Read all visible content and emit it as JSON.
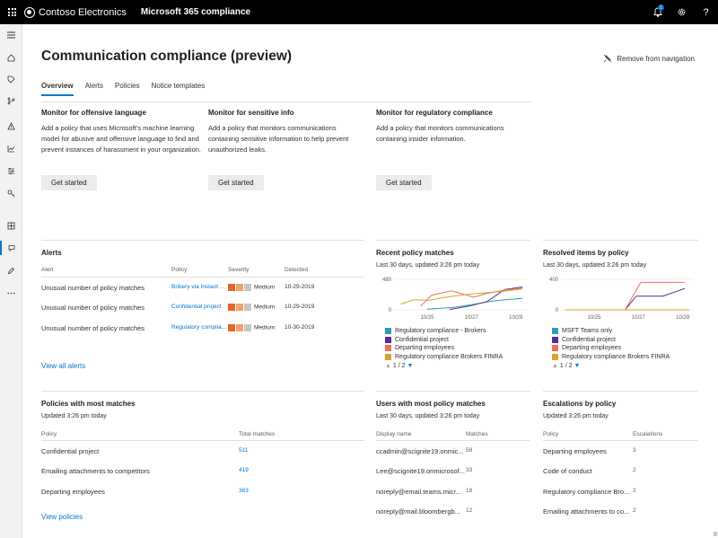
{
  "topbar": {
    "brand": "Contoso Electronics",
    "app_name": "Microsoft 365 compliance",
    "notification_count": "1",
    "help": "?"
  },
  "page": {
    "title": "Communication compliance (preview)",
    "remove_nav": "Remove from navigation",
    "tabs": [
      "Overview",
      "Alerts",
      "Policies",
      "Notice templates"
    ]
  },
  "monitor_cards": [
    {
      "title": "Monitor for offensive language",
      "desc": "Add a policy that uses Microsoft's machine learning model for abusive and offensive language to find and prevent instances of harassment in your organization.",
      "button": "Get started"
    },
    {
      "title": "Monitor for sensitive info",
      "desc": "Add a policy that monitors communications containing sensitive information to help prevent unauthorized leaks.",
      "button": "Get started"
    },
    {
      "title": "Monitor for regulatory compliance",
      "desc": "Add a policy that monitors communications containing insider information.",
      "button": "Get started"
    }
  ],
  "alerts": {
    "title": "Alerts",
    "headers": [
      "Alert",
      "Policy",
      "Severity",
      "Detected"
    ],
    "rows": [
      {
        "alert": "Unusual number of policy matches",
        "policy": "Bribery via Instant ...",
        "severity": "Medium",
        "detected": "10-29-2019"
      },
      {
        "alert": "Unusual number of policy matches",
        "policy": "Confidential project",
        "severity": "Medium",
        "detected": "10-29-2019"
      },
      {
        "alert": "Unusual number of policy matches",
        "policy": "Regulatory complia...",
        "severity": "Medium",
        "detected": "10-30-2019"
      }
    ],
    "view_all": "View all alerts"
  },
  "recent_matches": {
    "title": "Recent policy matches",
    "subtitle": "Last 30 days, updated 3:26 pm today",
    "legend": [
      "Regulatory compliance - Brokers",
      "Confidential project",
      "Departing employees",
      "Regulatory compliance Brokers FINRA"
    ],
    "pager": "1 / 2"
  },
  "resolved_items": {
    "title": "Resolved items by policy",
    "subtitle": "Last 30 days, updated 3:26 pm today",
    "legend": [
      "MSFT Teams only",
      "Confidential project",
      "Departing employees",
      "Regulatory compliance Brokers FINRA"
    ],
    "pager": "1 / 2"
  },
  "chart_data": [
    {
      "type": "line",
      "title": "Recent policy matches",
      "x": [
        "10/25",
        "10/27",
        "10/29"
      ],
      "ylim": [
        0,
        480
      ],
      "yticks": [
        0,
        480
      ],
      "series": [
        {
          "name": "Regulatory compliance - Brokers",
          "color": "#2b9fb3",
          "points": [
            [
              10.5,
              10
            ],
            [
              11.7,
              40
            ],
            [
              12.5,
              80
            ],
            [
              13.3,
              130
            ],
            [
              14.0,
              160
            ],
            [
              14.8,
              180
            ]
          ]
        },
        {
          "name": "Confidential project",
          "color": "#5c2d91",
          "points": [
            [
              11.5,
              5
            ],
            [
              12.4,
              60
            ],
            [
              13.2,
              130
            ],
            [
              14.0,
              320
            ],
            [
              14.8,
              360
            ]
          ]
        },
        {
          "name": "Departing employees",
          "color": "#e8735f",
          "points": [
            [
              10.2,
              60
            ],
            [
              10.7,
              230
            ],
            [
              11.6,
              300
            ],
            [
              12.6,
              200
            ],
            [
              13.2,
              260
            ],
            [
              14.0,
              310
            ],
            [
              14.8,
              340
            ]
          ]
        },
        {
          "name": "Regulatory compliance Brokers FINRA",
          "color": "#d6a52c",
          "points": [
            [
              9.3,
              90
            ],
            [
              9.9,
              160
            ],
            [
              10.6,
              150
            ],
            [
              11.2,
              190
            ],
            [
              11.8,
              220
            ],
            [
              12.5,
              250
            ],
            [
              13.2,
              270
            ],
            [
              13.9,
              290
            ],
            [
              14.8,
              330
            ]
          ]
        }
      ]
    },
    {
      "type": "line",
      "title": "Resolved items by policy",
      "x": [
        "10/25",
        "10/27",
        "10/29"
      ],
      "ylim": [
        0,
        400
      ],
      "yticks": [
        0,
        400
      ],
      "series": [
        {
          "name": "MSFT Teams only",
          "color": "#2b9fb3",
          "points": [
            [
              9.2,
              0
            ],
            [
              14.8,
              0
            ]
          ]
        },
        {
          "name": "Confidential project",
          "color": "#5c2d91",
          "points": [
            [
              9.2,
              0
            ],
            [
              11.9,
              0
            ],
            [
              12.4,
              180
            ],
            [
              13.6,
              180
            ],
            [
              14.6,
              280
            ]
          ]
        },
        {
          "name": "Departing employees",
          "color": "#e8735f",
          "points": [
            [
              9.2,
              0
            ],
            [
              11.9,
              0
            ],
            [
              12.6,
              360
            ],
            [
              14.6,
              360
            ]
          ]
        },
        {
          "name": "Regulatory compliance Brokers FINRA",
          "color": "#d6a52c",
          "points": [
            [
              9.2,
              0
            ],
            [
              14.8,
              0
            ]
          ]
        }
      ]
    }
  ],
  "policies_most": {
    "title": "Policies with most matches",
    "subtitle": "Updated 3:26 pm today",
    "headers": [
      "Policy",
      "Total matches"
    ],
    "rows": [
      {
        "name": "Confidential project",
        "value": "511"
      },
      {
        "name": "Emailing attachments to competitors",
        "value": "419"
      },
      {
        "name": "Departing employees",
        "value": "363"
      }
    ],
    "view": "View policies"
  },
  "users_most": {
    "title": "Users with most policy matches",
    "subtitle": "Last 30 days, updated 3:26 pm today",
    "headers": [
      "Display name",
      "Matches"
    ],
    "rows": [
      {
        "name": "ccadmin@scignite19.onmic...",
        "value": "59"
      },
      {
        "name": "Lee@scignite19.onmicrosof...",
        "value": "33"
      },
      {
        "name": "noreply@email.teams.micr...",
        "value": "18"
      },
      {
        "name": "noreply@mail.bloombergb...",
        "value": "12"
      }
    ]
  },
  "escalations": {
    "title": "Escalations by policy",
    "subtitle": "Updated 3:26 pm today",
    "headers": [
      "Policy",
      "Escalations"
    ],
    "rows": [
      {
        "name": "Departing employees",
        "value": "3"
      },
      {
        "name": "Code of conduct",
        "value": "2"
      },
      {
        "name": "Regulatory compliance Bro...",
        "value": "2"
      },
      {
        "name": "Emailing attachments to co...",
        "value": "2"
      }
    ]
  },
  "colors": {
    "accent": "#0078d4",
    "sev_high": "#e8652a",
    "sev_med": "#f2a06e",
    "sev_low": "#c8c6c4"
  }
}
